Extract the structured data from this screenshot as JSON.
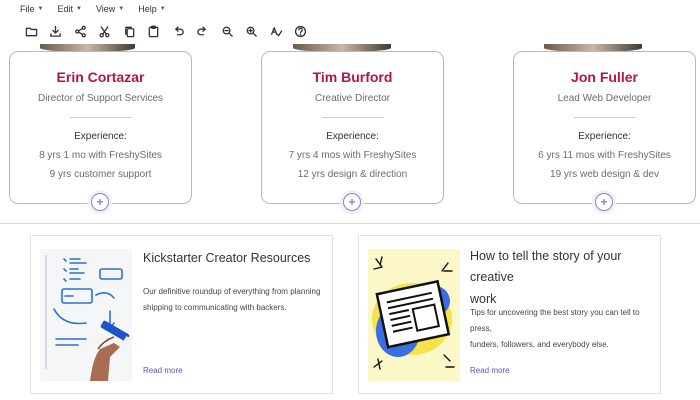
{
  "menu": [
    {
      "label": "File"
    },
    {
      "label": "Edit"
    },
    {
      "label": "View"
    },
    {
      "label": "Help"
    }
  ],
  "toolbar_icons": [
    "folder-icon",
    "download-icon",
    "share-icon",
    "cut-icon",
    "copy-icon",
    "paste-icon",
    "undo-icon",
    "redo-icon",
    "zoom-out-icon",
    "zoom-in-icon",
    "spellcheck-icon",
    "help-icon"
  ],
  "team": [
    {
      "name": "Erin Cortazar",
      "role": "Director of Support Services",
      "experience_label": "Experience:",
      "line1": "8 yrs 1 mo with FreshySites",
      "line2": "9 yrs customer support"
    },
    {
      "name": "Tim Burford",
      "role": "Creative Director",
      "experience_label": "Experience:",
      "line1": "7 yrs 4 mos with FreshySites",
      "line2": "12 yrs design & direction"
    },
    {
      "name": "Jon Fuller",
      "role": "Lead Web Developer",
      "experience_label": "Experience:",
      "line1": "6 yrs 11 mos with FreshySites",
      "line2": "19 yrs web design & dev"
    }
  ],
  "articles": [
    {
      "title": "Kickstarter Creator Resources",
      "desc_line1": "Our definitive roundup of everything from planning",
      "desc_line2": "shipping to communicating with backers.",
      "link": "Read more"
    },
    {
      "title_line1": "How to tell the story of your creative",
      "title_line2": "work",
      "desc_line1": "Tips for uncovering the best story you can tell to press,",
      "desc_line2": "funders, followers, and everybody else.",
      "link": "Read more"
    }
  ],
  "colors": {
    "name_accent": "#b5124a",
    "link": "#5a57b7",
    "add_button": "#8d83c9"
  }
}
